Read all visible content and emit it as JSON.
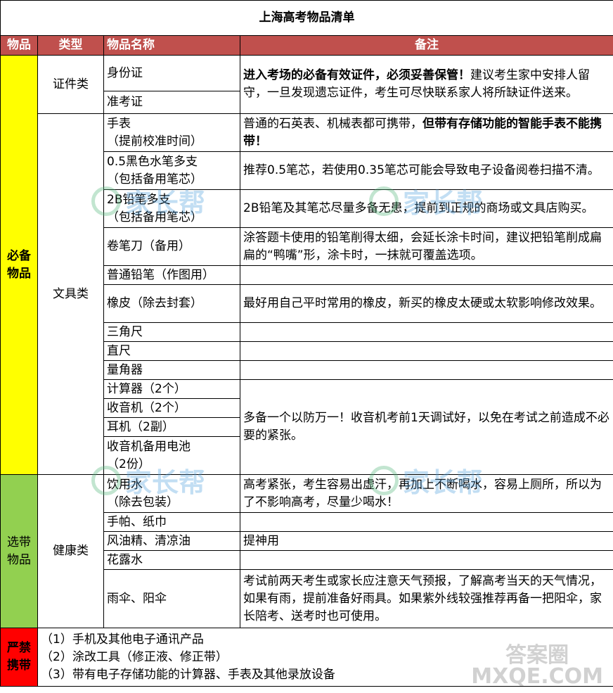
{
  "title": "上海高考物品清单",
  "headers": {
    "col1": "物品",
    "col2": "类型",
    "col3": "物品名称",
    "col4": "备注"
  },
  "required": {
    "label": "必备\n物品",
    "id_docs": {
      "type": "证件类",
      "items": [
        "身份证",
        "准考证"
      ],
      "note_bold": "进入考场的必备有效证件，必须妥善保管！",
      "note_rest": "建议考生家中安排人留守，一旦发现遗忘证件，考生可尽快联系家人将所缺证件送来。"
    },
    "stationery": {
      "type": "文具类",
      "rows": [
        {
          "item": "手表\n（提前校准时间）",
          "note_plain": "普通的石英表、机械表都可携带，",
          "note_bold": "但带有存储功能的智能手表不能携带！"
        },
        {
          "item": "0.5黑色水笔多支\n（包括备用笔芯）",
          "note_plain": "推荐0.5笔芯，若使用0.35笔芯可能会导致电子设备阅卷扫描不清。"
        },
        {
          "item": "2B铅笔多支\n（包括备用笔芯）",
          "note_plain": "2B铅笔及其笔芯尽量多备无患，提前到正规的商场或文具店购买。"
        },
        {
          "item": "卷笔刀（备用）",
          "note_plain": "涂答题卡使用的铅笔削得太细，会延长涂卡时间，建议把铅笔削成扁扁的“鸭嘴”形，涂卡时，一抹就可覆盖选项。"
        },
        {
          "item": "普通铅笔（作图用）",
          "note_plain": ""
        },
        {
          "item": "橡皮（除去封套）",
          "note_plain": "最好用自己平时常用的橡皮，新买的橡皮太硬或太软影响修改效果。"
        },
        {
          "item": "三角尺",
          "note_plain": ""
        },
        {
          "item": "直尺",
          "note_plain": ""
        },
        {
          "item": "量角器",
          "note_plain": ""
        }
      ],
      "group_items": [
        "计算器（2个）",
        "收音机（2个）",
        "耳机（2副）",
        "收音机备用电池\n（2份）"
      ],
      "group_note": "多备一个以防万一！收音机考前1天调试好，以免在考试之前造成不必要的紧张。"
    }
  },
  "optional": {
    "label": "选带\n物品",
    "type": "健康类",
    "rows": [
      {
        "item": "饮用水\n（除去包装）",
        "note": "高考紧张，考生容易出虚汗，再加上不断喝水，容易上厕所，所以为了不影响高考，尽量少喝水！"
      },
      {
        "item": "手帕、纸巾",
        "note": ""
      },
      {
        "item": "风油精、清凉油",
        "note": "提神用"
      },
      {
        "item": "花露水",
        "note": ""
      },
      {
        "item": "雨伞、阳伞",
        "note": "考试前两天考生或家长应注意天气预报，了解高考当天的天气情况，如果有雨，提前准备好雨具。如果紫外线较强推荐再备一把阳伞，家长陪考、送考时也可使用。"
      }
    ]
  },
  "forbidden": {
    "label": "严禁\n携带",
    "items": [
      "（1）手机及其他电子通讯产品",
      "（2）涂改工具（修正液、修正带）",
      "（3）带有电子存储功能的计算器、手表及其他录放设备"
    ]
  },
  "watermarks": {
    "brand": "家长帮",
    "site_top": "答案圈",
    "site_bottom": "MXQE.COM"
  },
  "colors": {
    "header": "#c0504d",
    "required": "#ffff00",
    "optional": "#92d050",
    "forbidden": "#ff0000"
  }
}
